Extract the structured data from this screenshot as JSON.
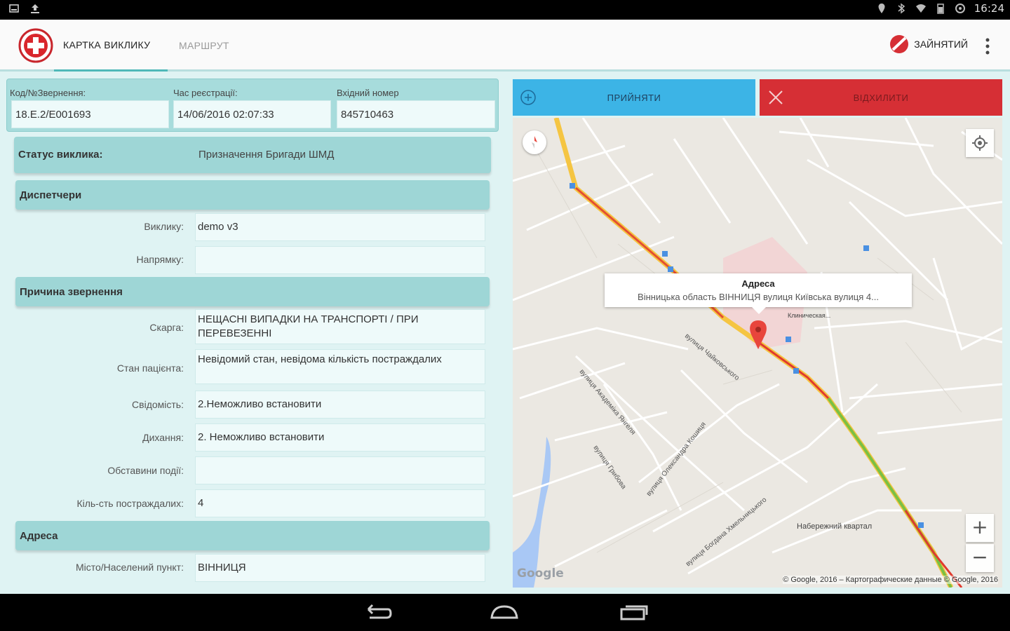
{
  "status_bar": {
    "time": "16:24"
  },
  "app_bar": {
    "tabs": [
      {
        "label": "КАРТКА ВИКЛИКУ",
        "active": true
      },
      {
        "label": "МАРШРУТ",
        "active": false
      }
    ],
    "busy_label": "ЗАЙНЯТИЙ"
  },
  "call_header": {
    "code_label": "Код/№Звернення:",
    "code_value": "18.E.2/E001693",
    "reg_time_label": "Час реєстрації:",
    "reg_time_value": "14/06/2016 02:07:33",
    "incoming_label": "Вхідний номер",
    "incoming_value": "845710463"
  },
  "call_status": {
    "label": "Статус виклика:",
    "value": "Призначення Бригади ШМД"
  },
  "dispatchers": {
    "title": "Диспетчери",
    "call_label": "Виклику:",
    "call_value": "demo v3",
    "direction_label": "Напрямку:",
    "direction_value": ""
  },
  "reason": {
    "title": "Причина звернення",
    "complaint_label": "Скарга:",
    "complaint_value": "НЕЩАСНІ ВИПАДКИ НА ТРАНСПОРТІ / ПРИ ПЕРЕВЕЗЕННІ",
    "patient_label": "Стан пацієнта:",
    "patient_value": "Невідомий стан, невідома кількість постраждалих",
    "conscious_label": "Свідомість:",
    "conscious_value": "2.Неможливо встановити",
    "breath_label": "Дихання:",
    "breath_value": "2. Неможливо встановити",
    "circumstances_label": "Обставини події:",
    "circumstances_value": "",
    "victims_label": "Кіль-сть постраждалих:",
    "victims_value": "4"
  },
  "address": {
    "title": "Адреса",
    "city_label": "Місто/Населений пункт:",
    "city_value": "ВІННИЦЯ"
  },
  "actions": {
    "accept_label": "ПРИЙНЯТИ",
    "reject_label": "ВІДХИЛИТИ"
  },
  "map": {
    "info_title": "Адреса",
    "info_subtitle": "Вінницька область ВІННИЦЯ вулиця Київська вулиця 4...",
    "streets": [
      "вулиця Чайковського",
      "вулиця Академіка Янгеля",
      "вулиця Грибова",
      "вулиця Олександра Кошиця",
      "вулиця Богдана Хмельницького"
    ],
    "poi_clinic": "Клиническая...",
    "poi_quarter": "Набережний квартал",
    "google_logo": "Google",
    "attribution": "© Google, 2016 – Картографические данные © Google, 2016",
    "colors": {
      "route_yellow": "#f5c542",
      "route_red": "#e03a2e",
      "route_green": "#7bc043",
      "marker": "#e8453c"
    }
  }
}
